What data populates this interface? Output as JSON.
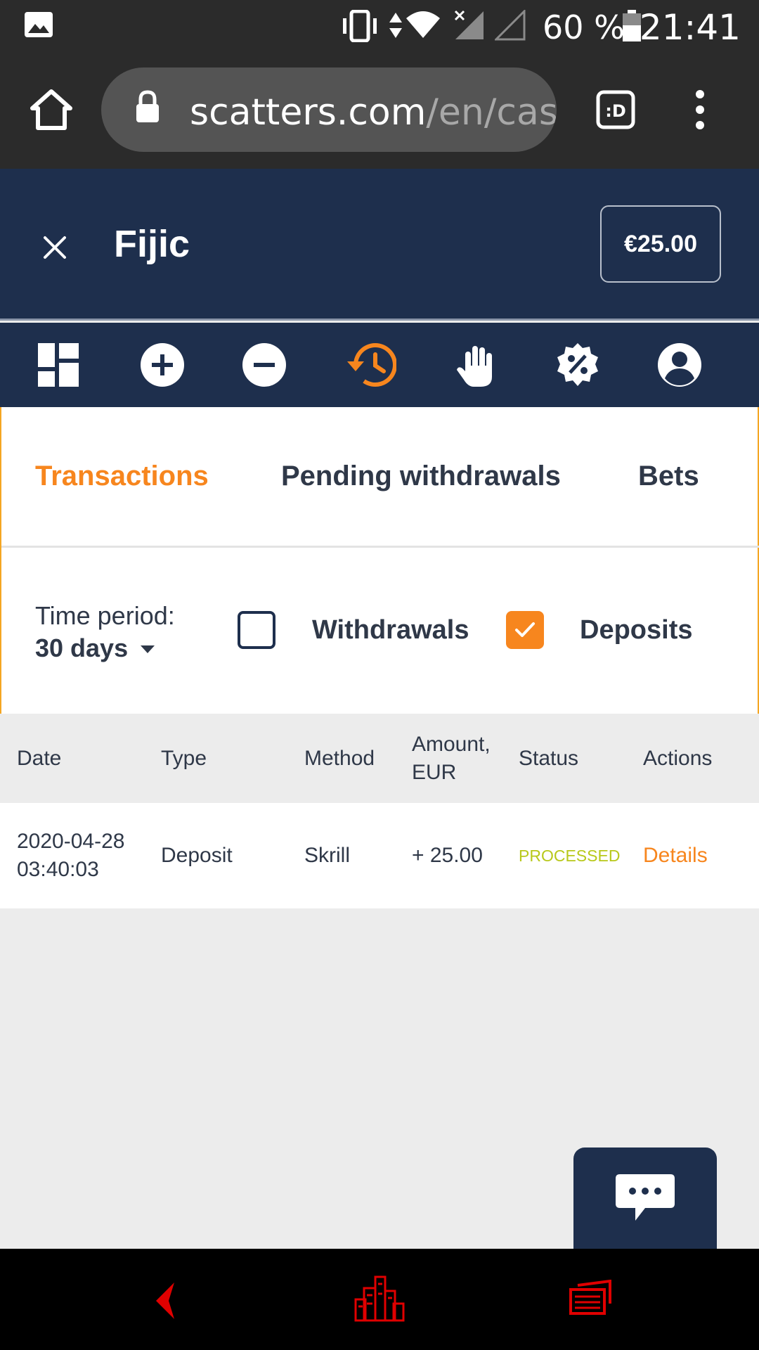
{
  "status_bar": {
    "battery_text": "60 %",
    "time": "21:41"
  },
  "browser": {
    "url_main": "scatters.com",
    "url_rest": "/en/cas"
  },
  "header": {
    "username": "Fijic",
    "balance": "€25.00"
  },
  "nav_icons": [
    "dashboard-icon",
    "deposit-plus-icon",
    "withdraw-minus-icon",
    "history-icon",
    "limits-hand-icon",
    "bonus-percent-icon",
    "profile-icon"
  ],
  "tabs": [
    {
      "label": "Transactions",
      "active": true
    },
    {
      "label": "Pending withdrawals",
      "active": false
    },
    {
      "label": "Bets",
      "active": false
    }
  ],
  "filters": {
    "time_period_label": "Time period:",
    "time_period_value": "30 days",
    "withdrawals_label": "Withdrawals",
    "withdrawals_checked": false,
    "deposits_label": "Deposits",
    "deposits_checked": true
  },
  "table": {
    "headers": {
      "date": "Date",
      "type": "Type",
      "method": "Method",
      "amount_line1": "Amount,",
      "amount_line2": "EUR",
      "status": "Status",
      "actions": "Actions"
    },
    "rows": [
      {
        "date": "2020-04-28",
        "time": "03:40:03",
        "type": "Deposit",
        "method": "Skrill",
        "amount": "+ 25.00",
        "status": "PROCESSED",
        "action": "Details"
      }
    ]
  },
  "colors": {
    "accent": "#f7861e",
    "header_bg": "#1e2f4d",
    "status_processed": "#b8c81a"
  }
}
